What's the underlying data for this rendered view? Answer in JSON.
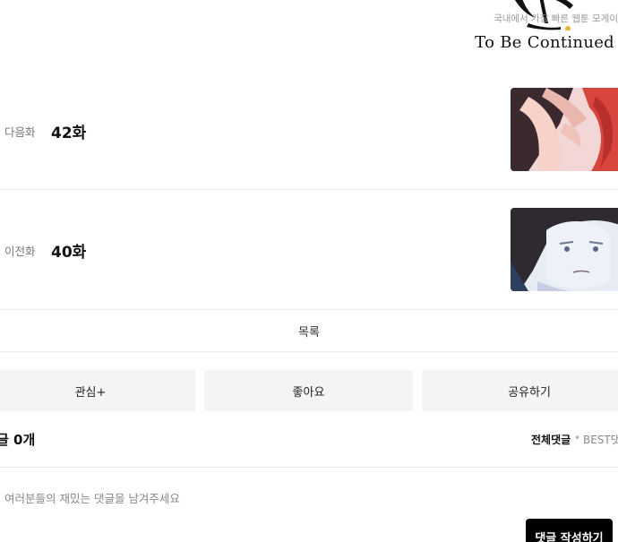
{
  "banner": {
    "tagline": "국내에서 가장 빠른 웹툰 모게이",
    "continued_text": "To Be Continued"
  },
  "episodes": {
    "next": {
      "kind_label": "다음화",
      "title": "42화",
      "thumb_icon": "next-episode-thumbnail"
    },
    "prev": {
      "kind_label": "이전화",
      "title": "40화",
      "thumb_icon": "previous-episode-thumbnail"
    }
  },
  "list_label": "목록",
  "actions": {
    "follow_label": "관심+",
    "like_label": "좋아요",
    "share_label": "공유하기"
  },
  "comments": {
    "count_label": "글 0개",
    "tab_all": "전체댓글",
    "tab_separator": "•",
    "tab_best": "BEST댓",
    "placeholder": "여러분들의 재밌는 댓글을 남겨주세요",
    "submit_label": "댓글 작성하기"
  }
}
